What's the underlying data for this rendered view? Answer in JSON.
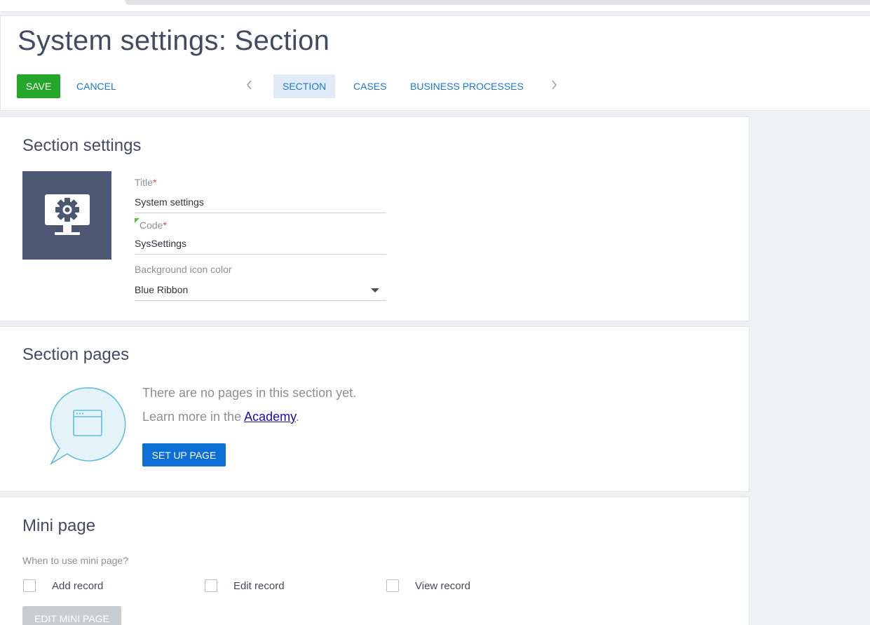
{
  "page": {
    "title": "System settings: Section"
  },
  "toolbar": {
    "save_label": "SAVE",
    "cancel_label": "CANCEL"
  },
  "tabs": [
    {
      "label": "SECTION",
      "active": true
    },
    {
      "label": "CASES",
      "active": false
    },
    {
      "label": "BUSINESS PROCESSES",
      "active": false
    }
  ],
  "icons": {
    "prev": "chevron-left-icon",
    "next": "chevron-right-icon",
    "section": "monitor-gear-icon",
    "pages": "speech-bubble-window-icon",
    "dropdown": "caret-down-icon"
  },
  "section_settings": {
    "heading": "Section settings",
    "icon_bg_color": "#4b5773",
    "title_label": "Title",
    "title_value": "System settings",
    "code_label": "Code",
    "code_value": "SysSettings",
    "color_label": "Background icon color",
    "color_value": "Blue Ribbon",
    "required_mark": "*"
  },
  "section_pages": {
    "heading": "Section pages",
    "empty_text": "There are no pages in this section yet.",
    "learn_prefix": "Learn more in the ",
    "learn_link": "Academy",
    "learn_suffix": ".",
    "setup_button": "SET UP PAGE"
  },
  "mini_page": {
    "heading": "Mini page",
    "question": "When to use mini page?",
    "options": [
      {
        "label": "Add record",
        "checked": false
      },
      {
        "label": "Edit record",
        "checked": false
      },
      {
        "label": "View record",
        "checked": false
      }
    ],
    "edit_button": "EDIT MINI PAGE"
  },
  "colors": {
    "save": "#23a629",
    "link": "#1f77c9",
    "primary_button": "#0d6ed6",
    "disabled_button": "#c9cdd2",
    "required": "#e0423a"
  }
}
